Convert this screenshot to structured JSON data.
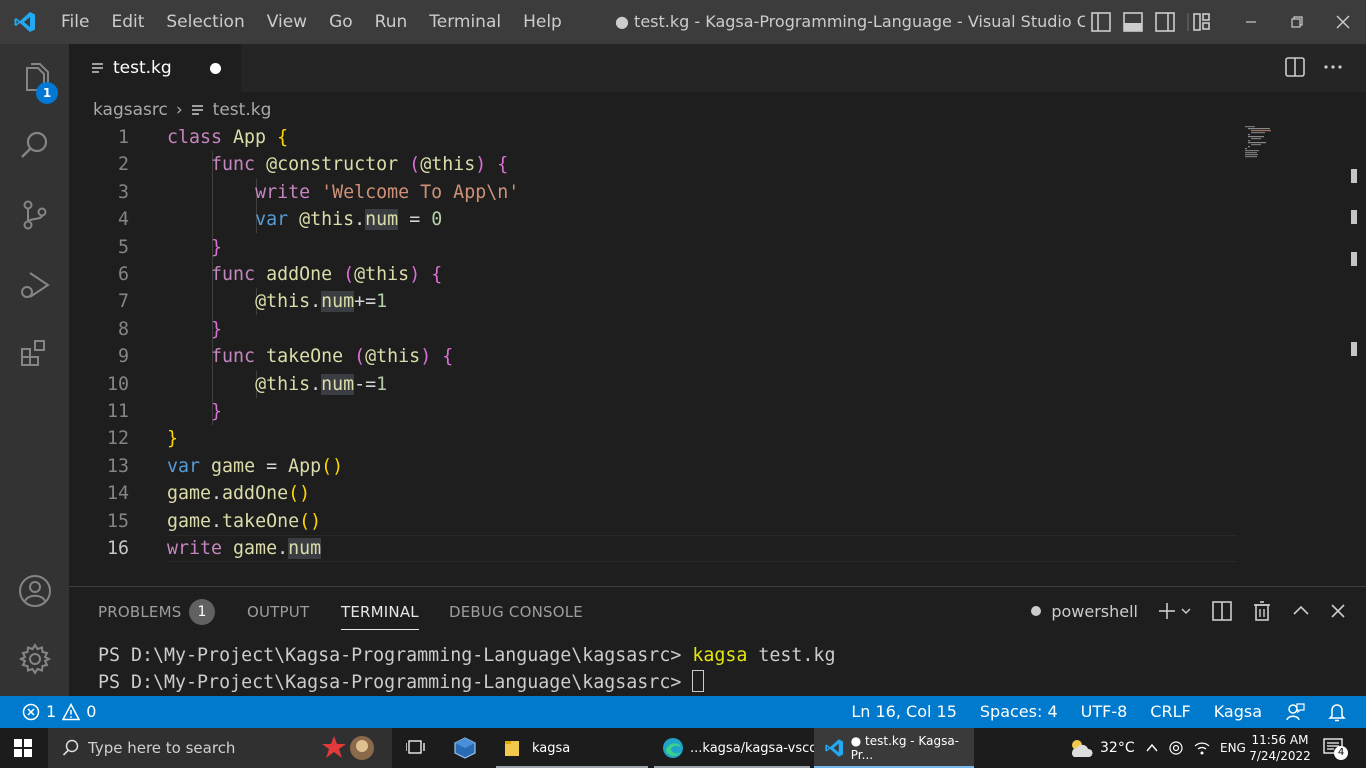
{
  "titlebar": {
    "menu": [
      "File",
      "Edit",
      "Selection",
      "View",
      "Go",
      "Run",
      "Terminal",
      "Help"
    ],
    "window_title": "● test.kg - Kagsa-Programming-Language - Visual Studio C..."
  },
  "activitybar": {
    "explorer_badge": "1"
  },
  "tab": {
    "label": "test.kg"
  },
  "breadcrumb": {
    "folder": "kagsasrc",
    "file": "test.kg"
  },
  "editor": {
    "line_numbers": [
      "1",
      "2",
      "3",
      "4",
      "5",
      "6",
      "7",
      "8",
      "9",
      "10",
      "11",
      "12",
      "13",
      "14",
      "15",
      "16"
    ],
    "lines": [
      "class App {",
      "    func @constructor (@this) {",
      "        write 'Welcome To App\\n'",
      "        var @this.num = 0",
      "    }",
      "    func addOne (@this) {",
      "        @this.num+=1",
      "    }",
      "    func takeOne (@this) {",
      "        @this.num-=1",
      "    }",
      "}",
      "var game = App()",
      "game.addOne()",
      "game.takeOne()",
      "write game.num"
    ]
  },
  "panel": {
    "tabs": [
      "PROBLEMS",
      "OUTPUT",
      "TERMINAL",
      "DEBUG CONSOLE"
    ],
    "problems_count": "1",
    "shell": "powershell",
    "terminal_prompt": "PS D:\\My-Project\\Kagsa-Programming-Language\\kagsasrc>",
    "terminal_cmd_name": "kagsa",
    "terminal_cmd_arg": "test.kg"
  },
  "statusbar": {
    "errors": "1",
    "warnings": "0",
    "position": "Ln 16, Col 15",
    "spaces": "Spaces: 4",
    "encoding": "UTF-8",
    "eol": "CRLF",
    "language": "Kagsa"
  },
  "taskbar": {
    "search_placeholder": "Type here to search",
    "apps": [
      "kagsa",
      "...kagsa/kagsa-vscod",
      "● test.kg - Kagsa-Pr..."
    ],
    "weather": "32°C",
    "lang": "ENG",
    "time": "11:56 AM",
    "date": "7/24/2022",
    "notifications": "4"
  },
  "colors": {
    "accent": "#007acc",
    "keyword": "#c586c0",
    "storage": "#569cd6",
    "function": "#dcdcaa",
    "string": "#ce9178",
    "number": "#b5cea8"
  }
}
